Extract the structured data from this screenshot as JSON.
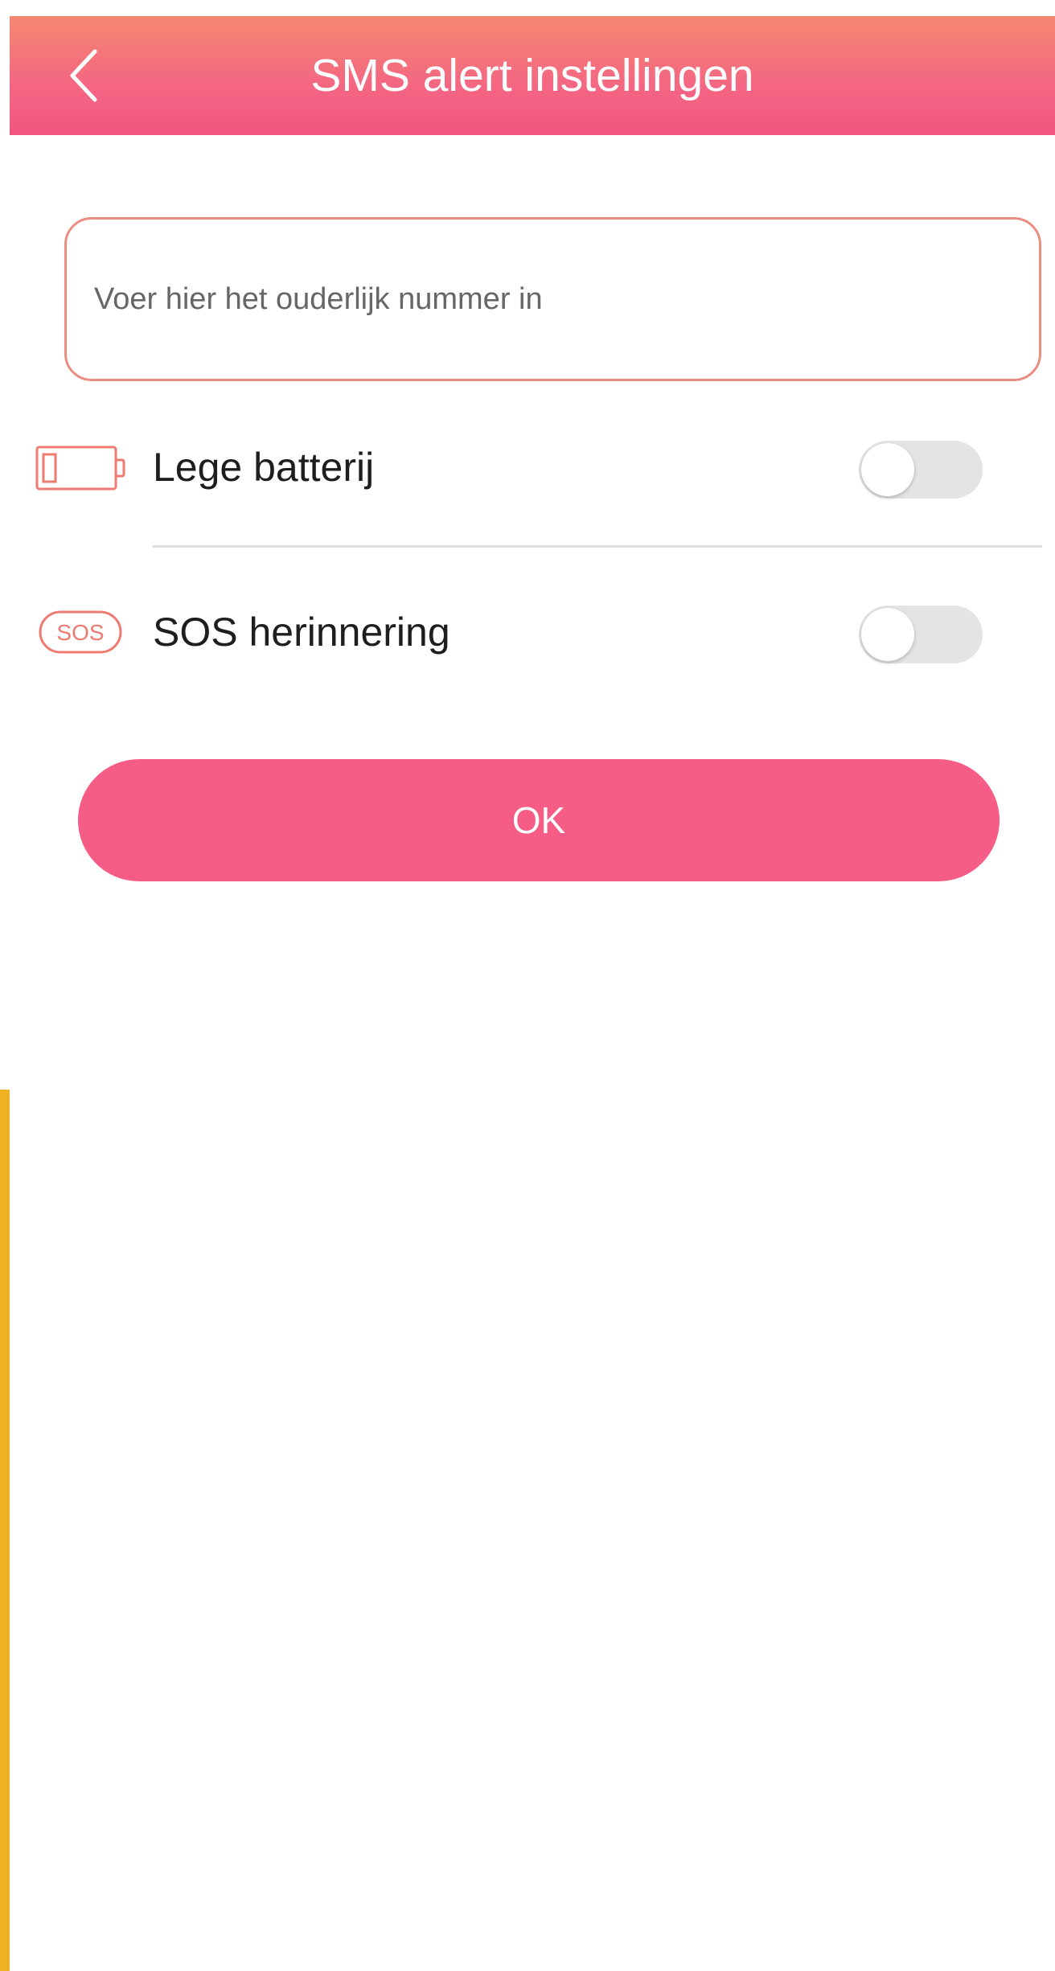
{
  "header": {
    "title": "SMS alert instellingen",
    "back_icon": "chevron-left-icon",
    "gradient_top": "#f5876f",
    "gradient_bottom": "#f2557e"
  },
  "number_input": {
    "placeholder": "Voer hier het ouderlijk nummer in",
    "value": "",
    "border_color": "#ec8d82"
  },
  "settings": [
    {
      "icon": "battery-low-icon",
      "label": "Lege batterij",
      "enabled": false
    },
    {
      "icon": "sos-icon",
      "label": "SOS herinnering",
      "enabled": false
    }
  ],
  "ok_button": {
    "label": "OK",
    "color": "#f55c86"
  },
  "colors": {
    "accent": "#f55c86",
    "icon": "#ee7b72",
    "toggle_off": "#e4e4e4"
  }
}
